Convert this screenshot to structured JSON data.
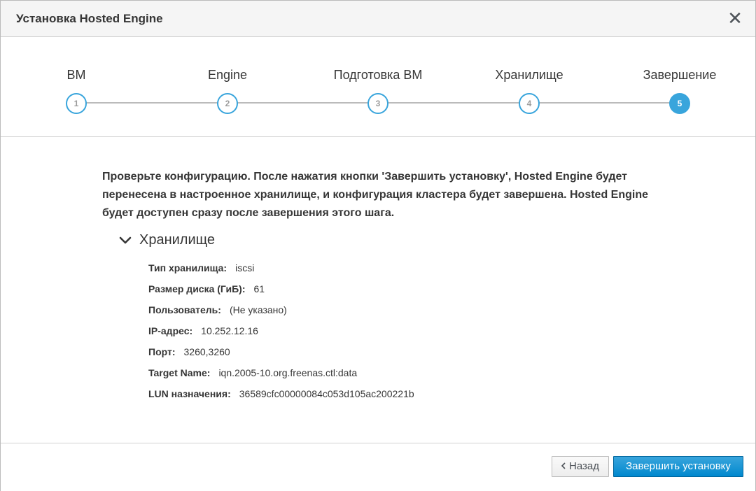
{
  "header": {
    "title": "Установка Hosted Engine",
    "close_glyph": "✕"
  },
  "wizard": {
    "steps": [
      {
        "label": "ВМ",
        "number": "1"
      },
      {
        "label": "Engine",
        "number": "2"
      },
      {
        "label": "Подготовка ВМ",
        "number": "3"
      },
      {
        "label": "Хранилище",
        "number": "4"
      },
      {
        "label": "Завершение",
        "number": "5"
      }
    ],
    "active_step": 5,
    "accent_color": "#39a5dc"
  },
  "content": {
    "intro": "Проверьте конфигурацию. После нажатия кнопки 'Завершить установку', Hosted Engine будет перенесена в настроенное хранилище, и конфигурация кластера будет завершена. Hosted Engine будет доступен сразу после завершения этого шага.",
    "section": {
      "title": "Хранилище",
      "expanded_icon": "chevron-down-icon",
      "properties": [
        {
          "key": "Тип хранилища:",
          "value": "iscsi"
        },
        {
          "key": "Размер диска (ГиБ):",
          "value": "61"
        },
        {
          "key": "Пользователь:",
          "value": "(Не указано)"
        },
        {
          "key": "IP-адрес:",
          "value": "10.252.12.16"
        },
        {
          "key": "Порт:",
          "value": "3260,3260"
        },
        {
          "key": "Target Name:",
          "value": "iqn.2005-10.org.freenas.ctl:data"
        },
        {
          "key": "LUN назначения:",
          "value": "36589cfc00000084c053d105ac200221b"
        }
      ]
    }
  },
  "footer": {
    "back_label": "Назад",
    "back_icon": "chevron-left-icon",
    "finish_label": "Завершить установку"
  }
}
